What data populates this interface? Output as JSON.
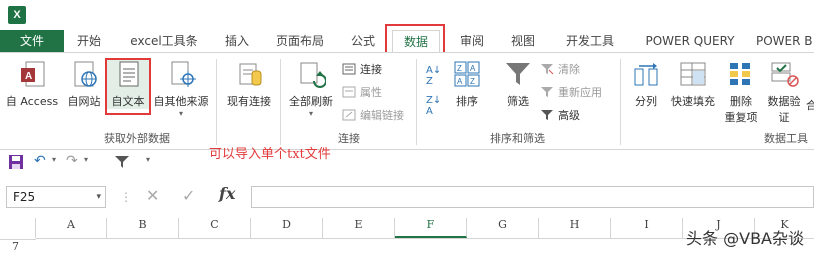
{
  "window": {
    "app_icon": "X"
  },
  "tabs": {
    "file": "文件",
    "items": [
      "开始",
      "excel工具条",
      "插入",
      "页面布局",
      "公式",
      "数据",
      "审阅",
      "视图",
      "开发工具",
      "POWER QUERY",
      "POWER B"
    ],
    "active": "数据"
  },
  "ribbon": {
    "get_external": {
      "label": "获取外部数据",
      "buttons": [
        "自 Access",
        "自网站",
        "自文本",
        "自其他来源",
        "现有连接"
      ]
    },
    "connections": {
      "label": "连接",
      "refresh_all": "全部刷新",
      "items": [
        "连接",
        "属性",
        "编辑链接"
      ]
    },
    "sort_filter": {
      "label": "排序和筛选",
      "sort": "排序",
      "filter": "筛选",
      "items": [
        "清除",
        "重新应用",
        "高级"
      ]
    },
    "data_tools": {
      "label": "数据工具",
      "split": "分列",
      "flash_fill": "快速填充",
      "remove_dup_1": "删除",
      "remove_dup_2": "重复项",
      "validation_1": "数据验",
      "validation_2": "证",
      "more": "合"
    }
  },
  "annotation": "可以导入单个txt文件",
  "formula_bar": {
    "name_box": "F25",
    "fx": "fx",
    "value": ""
  },
  "grid": {
    "columns": [
      "A",
      "B",
      "C",
      "D",
      "E",
      "F",
      "G",
      "H",
      "I",
      "J",
      "K"
    ],
    "selected_column": "F",
    "rows": [
      "7"
    ]
  },
  "watermark": "头条 @VBA杂谈",
  "colors": {
    "accent": "#217346",
    "highlight": "#e23a3a"
  }
}
